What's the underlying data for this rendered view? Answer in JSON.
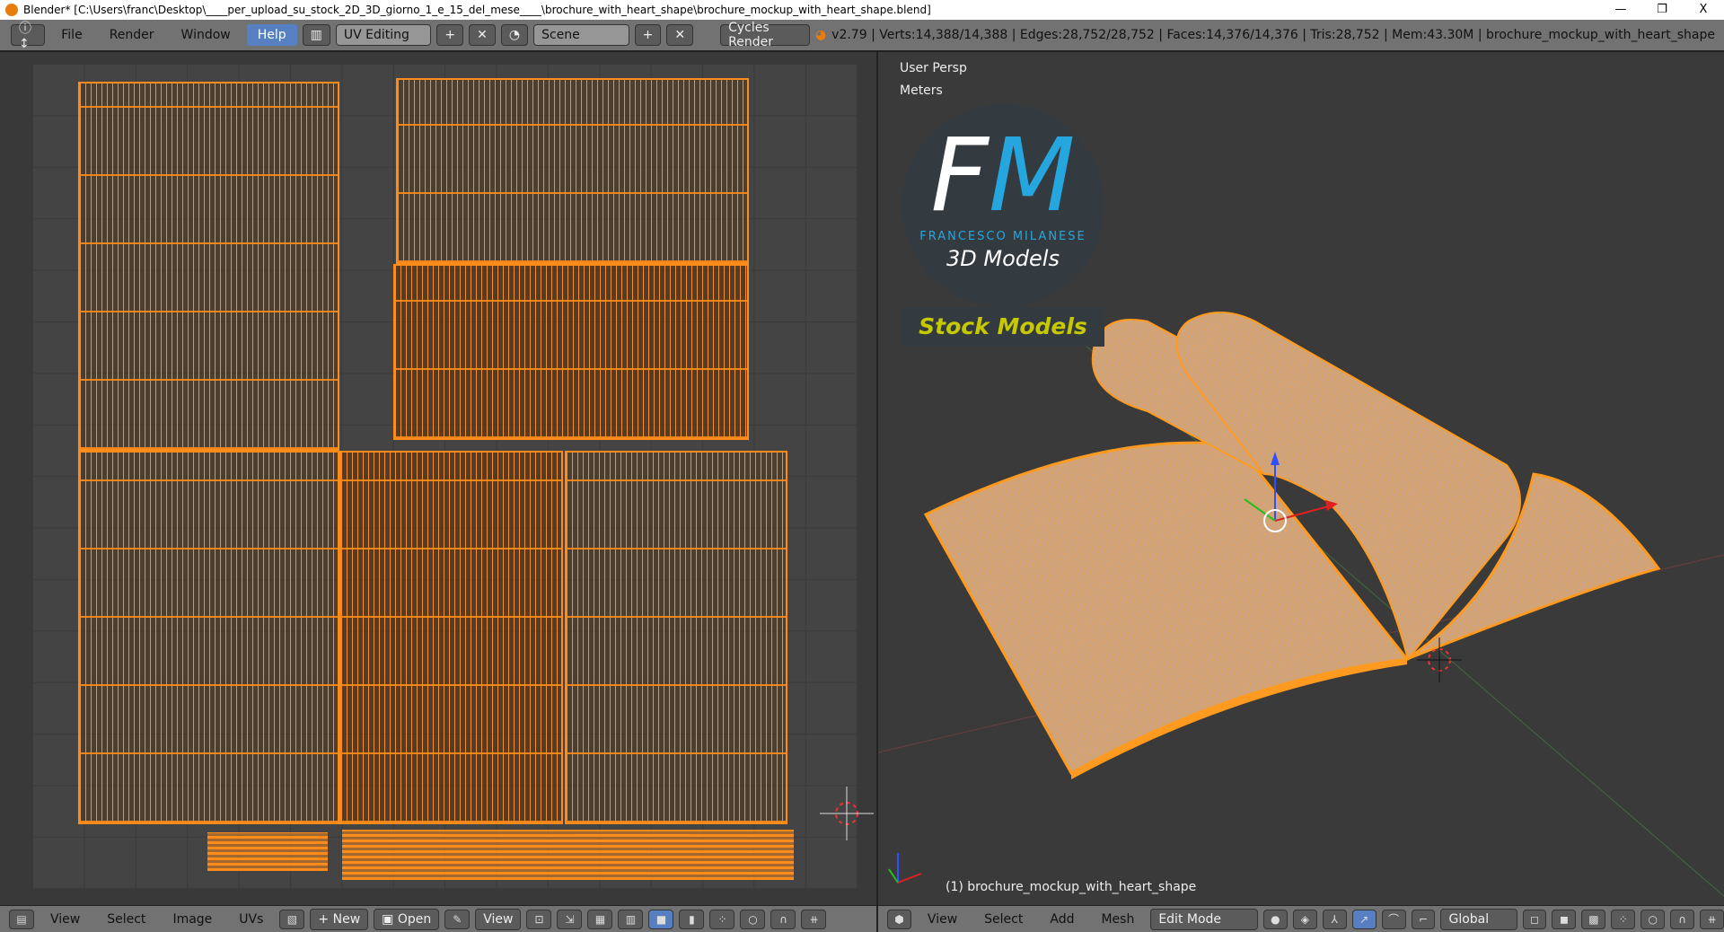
{
  "window": {
    "title": "Blender* [C:\\Users\\franc\\Desktop\\____per_upload_su_stock_2D_3D_giorno_1_e_15_del_mese____\\brochure_with_heart_shape\\brochure_mockup_with_heart_shape.blend]",
    "minimize": "—",
    "maximize": "❐",
    "close": "X"
  },
  "menu": [
    "File",
    "Render",
    "Window",
    "Help"
  ],
  "active_menu": "Help",
  "screen_layout": "UV Editing",
  "scene": "Scene",
  "render_engine": "Cycles Render",
  "stats": "v2.79 | Verts:14,388/14,388 | Edges:28,752/28,752 | Faces:14,376/14,376 | Tris:28,752 | Mem:43.30M | brochure_mockup_with_heart_shape",
  "uv_footer": {
    "menus": [
      "View",
      "Select",
      "Image",
      "UVs"
    ],
    "new": "New",
    "open": "Open",
    "view": "View"
  },
  "viewport": {
    "view_name": "User Persp",
    "units": "Meters",
    "object_label": "(1) brochure_mockup_with_heart_shape"
  },
  "logo": {
    "f": "F",
    "m": "M",
    "name": "FRANCESCO MILANESE",
    "sub": "3D Models",
    "badge": "Stock Models"
  },
  "view3d_footer": {
    "menus": [
      "View",
      "Select",
      "Add",
      "Mesh"
    ],
    "mode": "Edit Mode",
    "orientation": "Global"
  },
  "colors": {
    "uv_orange": "#ff8c1a",
    "accent_blue": "#5680c2",
    "logo_blue": "#26a6df",
    "badge_yellow": "#c6c800"
  }
}
